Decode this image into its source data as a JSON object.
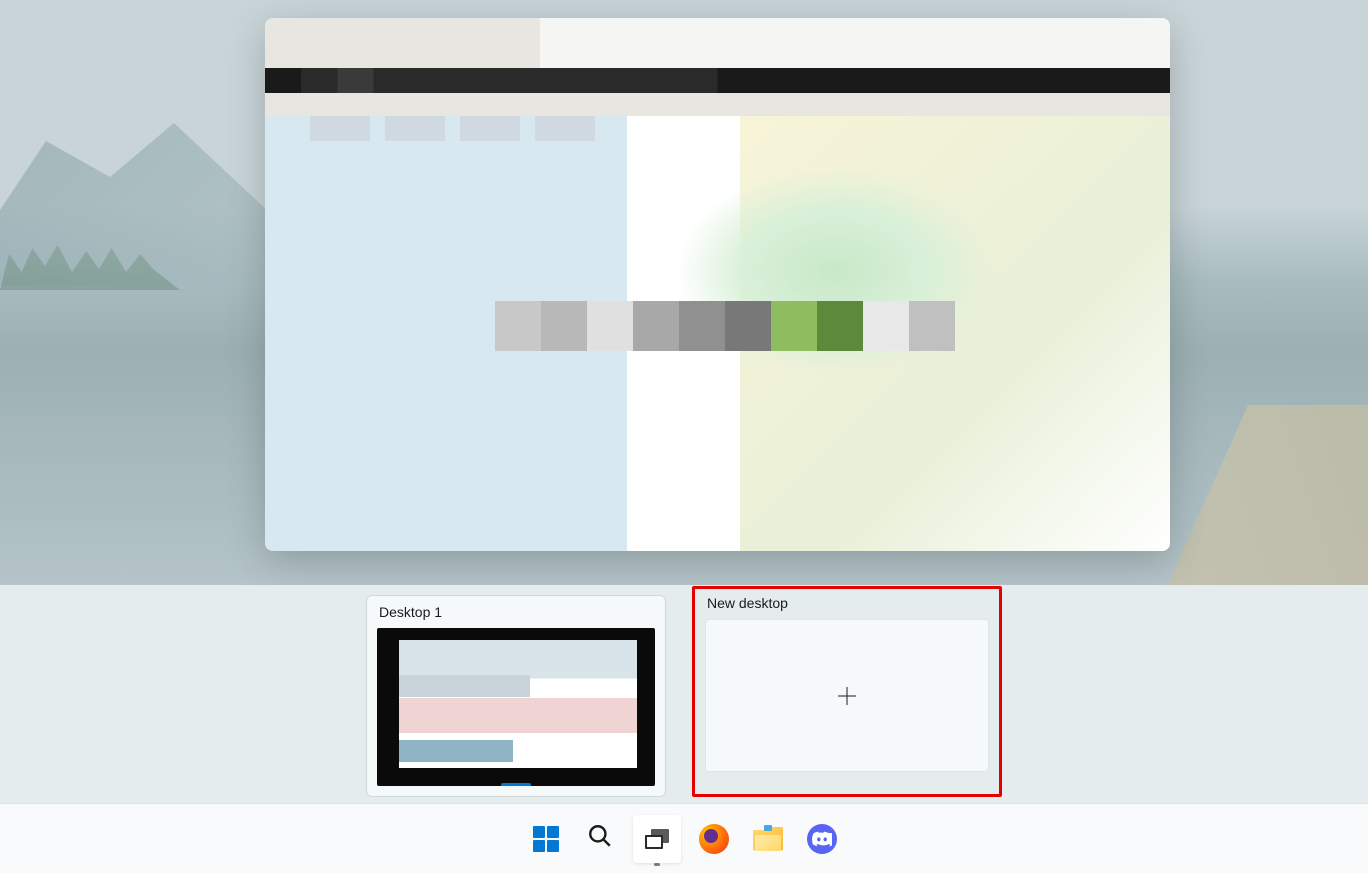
{
  "desktops": {
    "current": {
      "label": "Desktop 1"
    },
    "new": {
      "label": "New desktop"
    }
  },
  "taskbar": {
    "items": [
      {
        "name": "start",
        "label": "Start"
      },
      {
        "name": "search",
        "label": "Search"
      },
      {
        "name": "task-view",
        "label": "Task View",
        "active": true
      },
      {
        "name": "firefox",
        "label": "Firefox"
      },
      {
        "name": "file-explorer",
        "label": "File Explorer"
      },
      {
        "name": "discord",
        "label": "Discord"
      }
    ]
  }
}
